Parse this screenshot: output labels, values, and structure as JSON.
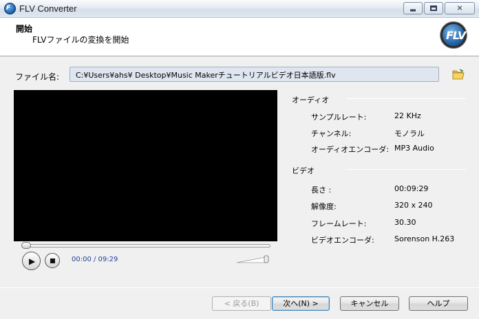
{
  "window": {
    "title": "FLV Converter"
  },
  "header": {
    "title": "開始",
    "subtitle": "FLVファイルの変換を開始"
  },
  "file": {
    "label": "ファイル名:",
    "path": "C:¥Users¥ahs¥ Desktop¥Music Makerチュートリアルビデオ日本語版.flv"
  },
  "player": {
    "time": "00:00 / 09:29",
    "progress": 0,
    "volume": 1.0
  },
  "audio": {
    "title": "オーディオ",
    "rows": [
      {
        "key": "サンプルレート:",
        "value": "22 KHz"
      },
      {
        "key": "チャンネル:",
        "value": "モノラル"
      },
      {
        "key": "オーディオエンコーダ:",
        "value": "MP3 Audio"
      }
    ]
  },
  "video": {
    "title": "ビデオ",
    "rows": [
      {
        "key": "長さ :",
        "value": "00:09:29"
      },
      {
        "key": "解像度:",
        "value": "320 x 240"
      },
      {
        "key": "フレームレート:",
        "value": "30.30"
      },
      {
        "key": "ビデオエンコーダ:",
        "value": "Sorenson H.263"
      }
    ]
  },
  "buttons": {
    "back": "< 戻る(B)",
    "next": "次へ(N) >",
    "cancel": "キャンセル",
    "help": "ヘルプ"
  }
}
